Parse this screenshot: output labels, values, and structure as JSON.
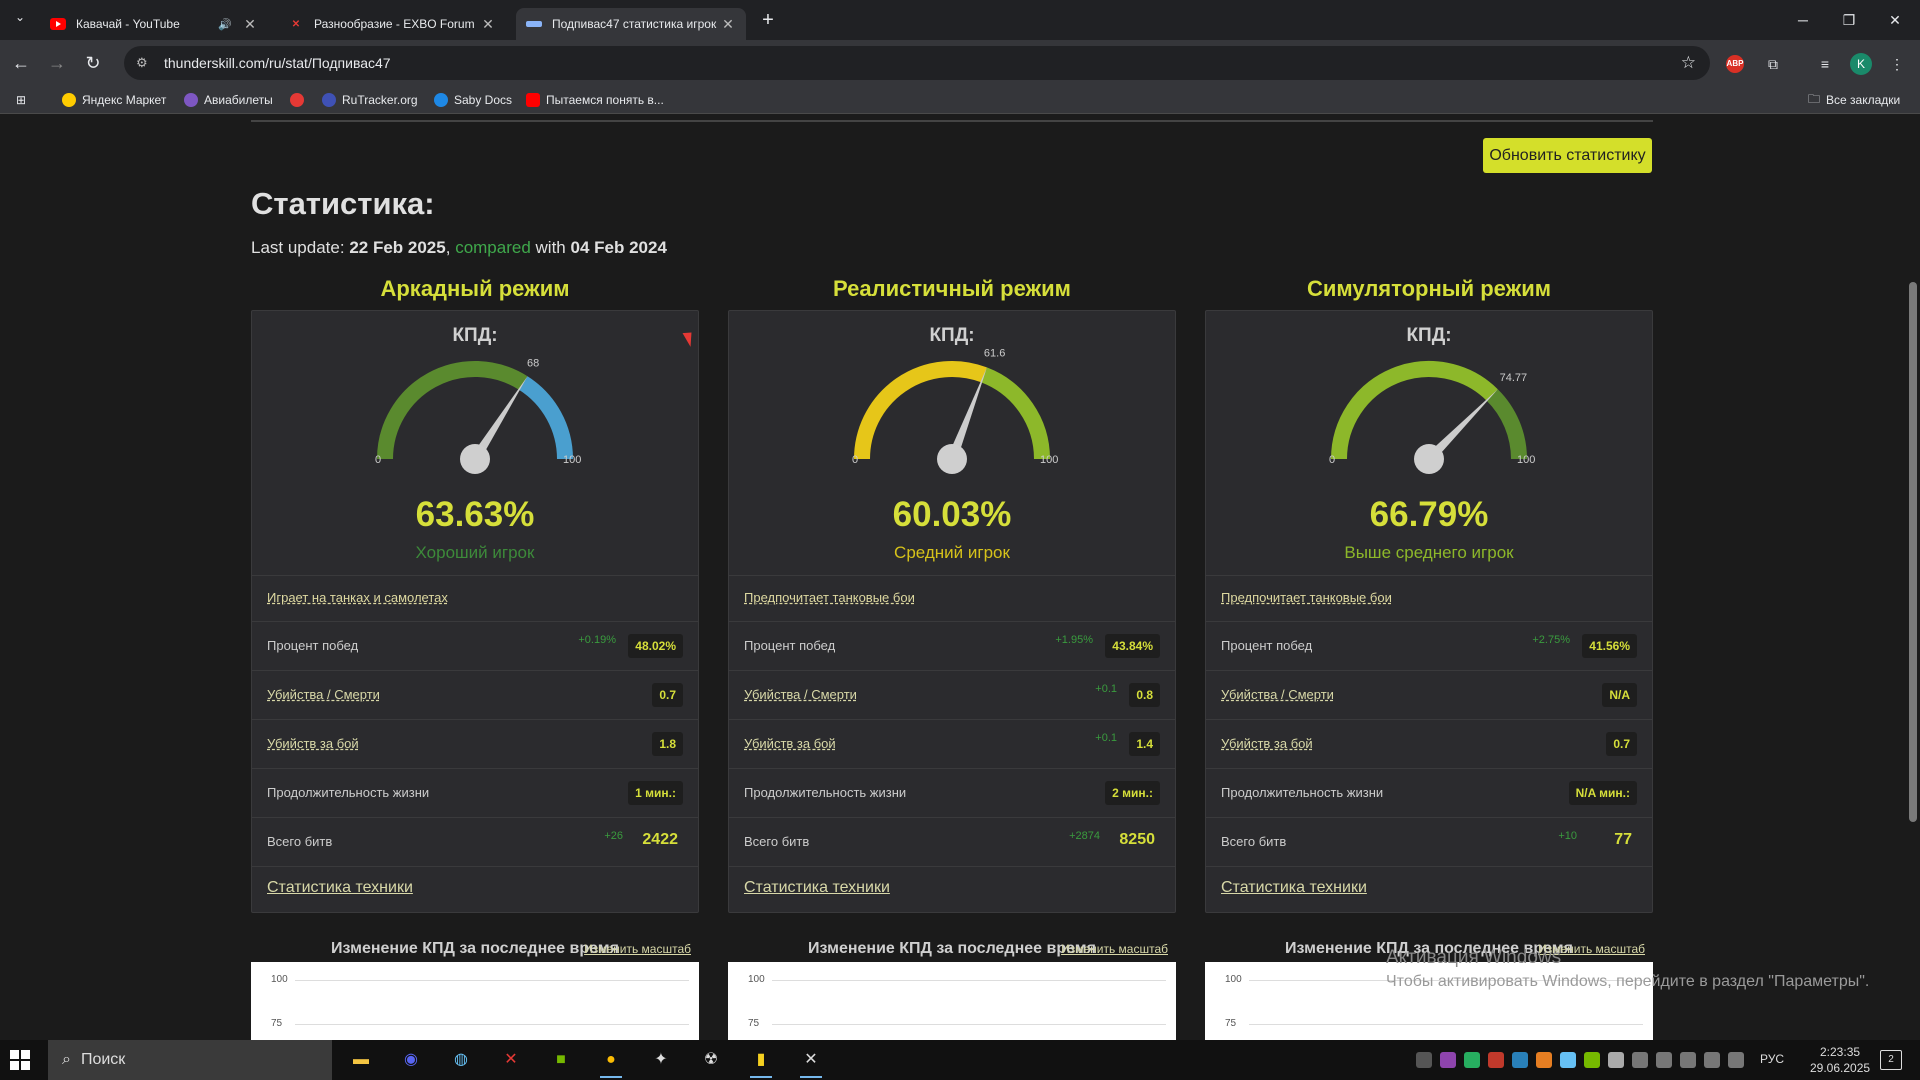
{
  "browser": {
    "tabs": [
      {
        "title": "Кавачай - YouTube",
        "icon": "youtube-icon",
        "color": "#ff0000"
      },
      {
        "title": "Разнообразие - EXBO Forum",
        "icon": "exbo-icon",
        "color": "#e53935"
      },
      {
        "title": "Подпивас47 статистика игрок",
        "icon": "thunderskill-icon",
        "color": "#8ab4f8"
      }
    ],
    "url": "thunderskill.com/ru/stat/Подпивас47",
    "avatar_letter": "K",
    "abp_label": "ABP"
  },
  "bookmarks": [
    {
      "label": "Яндекс Маркет",
      "color": "#ffcc00"
    },
    {
      "label": "Авиабилеты",
      "color": "#7e57c2"
    },
    {
      "label": "",
      "color": "#e53935"
    },
    {
      "label": "RuTracker.org",
      "color": "#3f51b5"
    },
    {
      "label": "Saby Docs",
      "color": "#1e88e5"
    },
    {
      "label": "Пытаемся понять в...",
      "color": "#ff0000"
    }
  ],
  "bookmarks_all": "Все закладки",
  "page": {
    "update_button": "Обновить статистику",
    "heading": "Статистика:",
    "last_update_prefix": "Last update:",
    "last_update_date": "22 Feb 2025",
    "comma": ",",
    "compared": "compared",
    "with_text": "with",
    "compared_date": "04 Feb 2024"
  },
  "modes": [
    {
      "title": "Аркадный режим",
      "kpd_label": "КПД:",
      "gauge_value": 68,
      "gauge_min": "0",
      "gauge_max": "100",
      "gauge_value_label": "68",
      "gauge_colors": [
        "#5a8a2e",
        "#4a9fcf"
      ],
      "percent": "63.63%",
      "rank": "Хороший игрок",
      "rank_color": "#3d8a3a",
      "plays": "Играет на танках и самолетах",
      "winrate_label": "Процент побед",
      "winrate_delta": "+0.19%",
      "winrate": "48.02%",
      "kd_label": "Убийства / Смерти",
      "kd_delta": "",
      "kd": "0.7",
      "kpb_label": "Убийств за бой",
      "kpb_delta": "",
      "kpb": "1.8",
      "life_label": "Продолжительность жизни",
      "life": "1 мин.:",
      "battles_label": "Всего битв",
      "battles_delta": "+26",
      "battles": "2422",
      "vehicle_stats": "Статистика техники"
    },
    {
      "title": "Реалистичный режим",
      "kpd_label": "КПД:",
      "gauge_value": 61.6,
      "gauge_min": "0",
      "gauge_max": "100",
      "gauge_value_label": "61.6",
      "gauge_colors": [
        "#e6c619",
        "#8db82a"
      ],
      "percent": "60.03%",
      "rank": "Средний игрок",
      "rank_color": "#d6c21a",
      "plays": "Предпочитает танковые бои",
      "winrate_label": "Процент побед",
      "winrate_delta": "+1.95%",
      "winrate": "43.84%",
      "kd_label": "Убийства / Смерти",
      "kd_delta": "+0.1",
      "kd": "0.8",
      "kpb_label": "Убийств за бой",
      "kpb_delta": "+0.1",
      "kpb": "1.4",
      "life_label": "Продолжительность жизни",
      "life": "2 мин.:",
      "battles_label": "Всего битв",
      "battles_delta": "+2874",
      "battles": "8250",
      "vehicle_stats": "Статистика техники"
    },
    {
      "title": "Симуляторный режим",
      "kpd_label": "КПД:",
      "gauge_value": 74.77,
      "gauge_min": "0",
      "gauge_max": "100",
      "gauge_value_label": "74.77",
      "gauge_colors": [
        "#8db82a",
        "#5a8a2e"
      ],
      "percent": "66.79%",
      "rank": "Выше среднего игрок",
      "rank_color": "#8db82a",
      "plays": "Предпочитает танковые бои",
      "winrate_label": "Процент побед",
      "winrate_delta": "+2.75%",
      "winrate": "41.56%",
      "kd_label": "Убийства / Смерти",
      "kd_delta": "",
      "kd": "N/A",
      "kpb_label": "Убийств за бой",
      "kpb_delta": "",
      "kpb": "0.7",
      "life_label": "Продолжительность жизни",
      "life": "N/A мин.:",
      "battles_label": "Всего битв",
      "battles_delta": "+10",
      "battles": "77",
      "vehicle_stats": "Статистика техники"
    }
  ],
  "kpd_chart": {
    "title": "Изменение КПД за последнее время",
    "scale_link": "Изменить масштаб",
    "ticks": [
      "100",
      "75"
    ]
  },
  "windows_activation": {
    "line1": "Активация Windows",
    "line2": "Чтобы активировать Windows, перейдите в раздел \"Параметры\"."
  },
  "taskbar": {
    "search": "Поиск",
    "lang": "РУС",
    "time": "2:23:35",
    "date": "29.06.2025",
    "notif_count": "2"
  }
}
